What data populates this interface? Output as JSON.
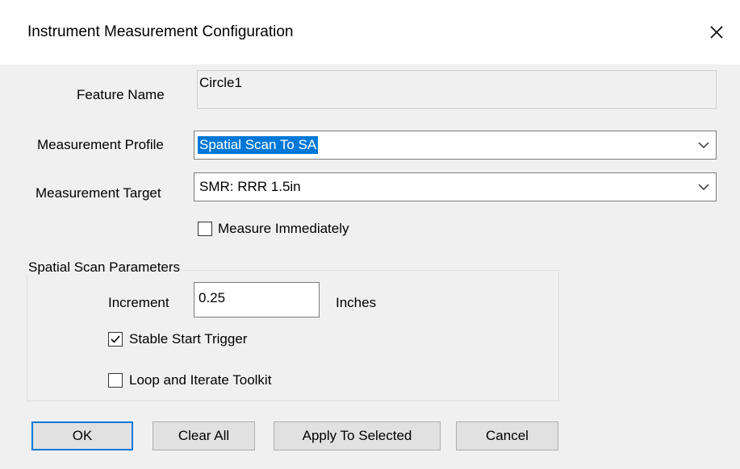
{
  "dialog": {
    "title": "Instrument Measurement Configuration",
    "close_icon": "close-icon"
  },
  "feature": {
    "label": "Feature Name",
    "value": "Circle1"
  },
  "profile": {
    "label": "Measurement Profile",
    "value": "Spatial Scan To SA",
    "icon": "chevron-down-icon"
  },
  "target": {
    "label": "Measurement Target",
    "value": "SMR: RRR 1.5in",
    "icon": "chevron-down-icon"
  },
  "measure_immediately": {
    "label": "Measure Immediately",
    "checked": false
  },
  "scan_params": {
    "title": "Spatial Scan Parameters",
    "increment_label": "Increment",
    "increment_value": "0.25",
    "unit": "Inches",
    "stable_start": {
      "label": "Stable Start Trigger",
      "checked": true
    },
    "loop_iterate": {
      "label": "Loop and Iterate Toolkit",
      "checked": false
    }
  },
  "buttons": {
    "ok": "OK",
    "clear_all": "Clear All",
    "apply_selected": "Apply To Selected",
    "cancel": "Cancel"
  },
  "colors": {
    "accent": "#0078d7",
    "window_bg": "#f0f0f0"
  }
}
